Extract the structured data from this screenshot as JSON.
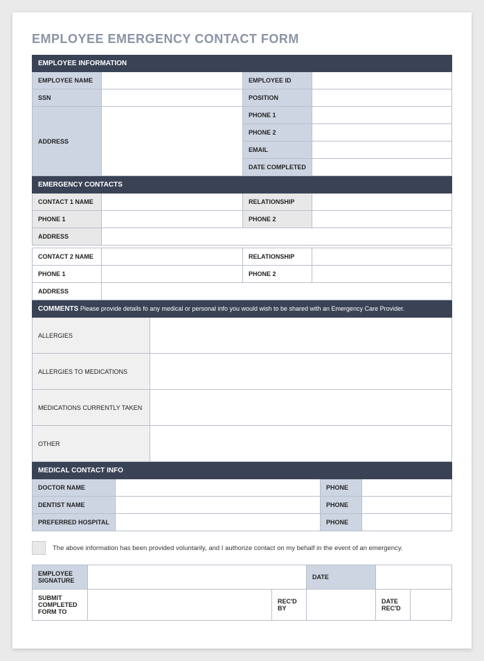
{
  "title": "EMPLOYEE EMERGENCY CONTACT FORM",
  "s1": {
    "header": "EMPLOYEE INFORMATION",
    "empName": "EMPLOYEE NAME",
    "empId": "EMPLOYEE ID",
    "ssn": "SSN",
    "position": "POSITION",
    "address": "ADDRESS",
    "phone1": "PHONE 1",
    "phone2": "PHONE 2",
    "email": "EMAIL",
    "dateCompleted": "DATE COMPLETED"
  },
  "s2": {
    "header": "EMERGENCY CONTACTS",
    "c1name": "CONTACT 1 NAME",
    "c2name": "CONTACT 2 NAME",
    "relationship": "RELATIONSHIP",
    "phone1": "PHONE 1",
    "phone2": "PHONE 2",
    "address": "ADDRESS"
  },
  "s3": {
    "headerLabel": "COMMENTS",
    "headerText": " Please provide details fo any medical or personal info you would wish to be shared with an Emergency Care Provider.",
    "allergies": "ALLERGIES",
    "allergiesMed": "ALLERGIES TO MEDICATIONS",
    "medsTaken": "MEDICATIONS CURRENTLY TAKEN",
    "other": "OTHER"
  },
  "s4": {
    "header": "MEDICAL CONTACT INFO",
    "doctor": "DOCTOR NAME",
    "dentist": "DENTIST NAME",
    "hospital": "PREFERRED HOSPITAL",
    "phone": "PHONE"
  },
  "auth": "The above information has been provided voluntarily, and I authorize contact on my behalf in the event of an emergency.",
  "sig": {
    "empSig": "EMPLOYEE SIGNATURE",
    "date": "DATE",
    "submitTo": "SUBMIT COMPLETED FORM TO",
    "recdBy": "REC'D BY",
    "dateRecd": "DATE REC'D"
  }
}
